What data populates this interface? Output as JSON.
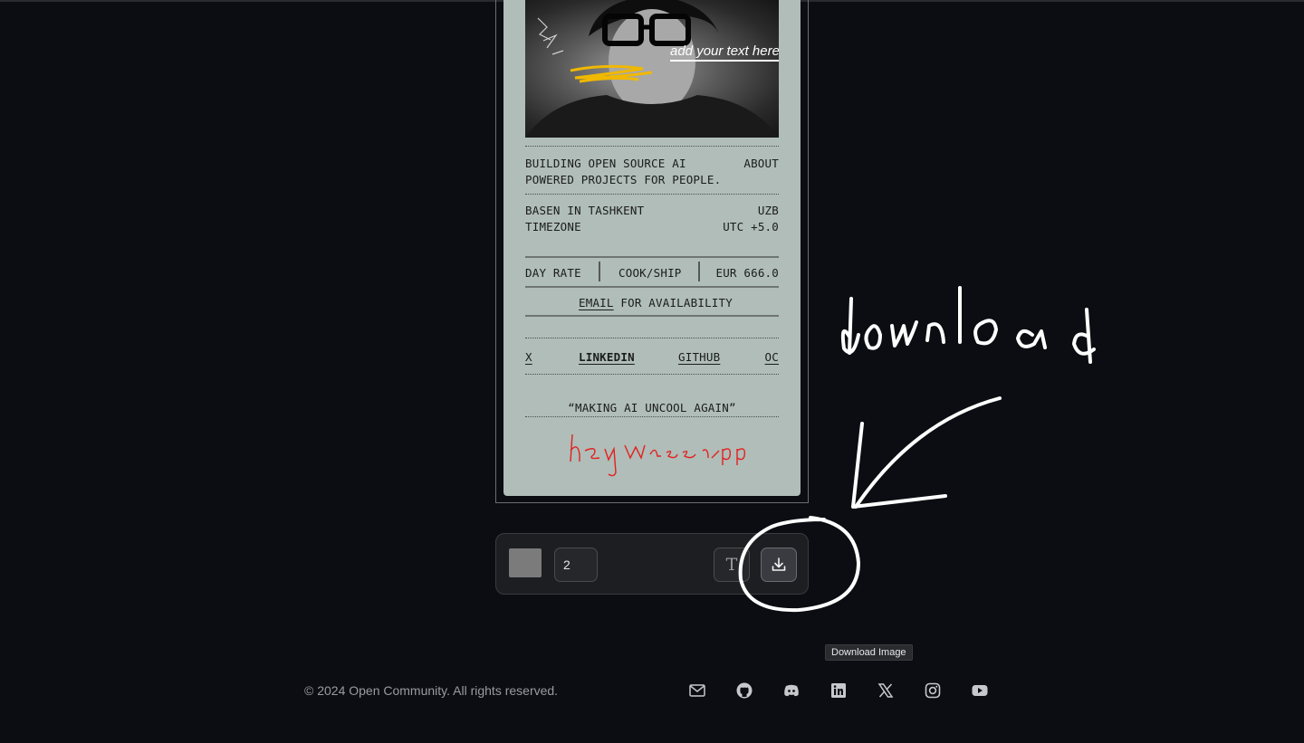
{
  "card": {
    "photo_caption": "add your text here",
    "about_text_1": "BUILDING OPEN SOURCE AI",
    "about_text_2": "POWERED PROJECTS FOR PEOPLE.",
    "about_label": "ABOUT",
    "location_1": "BASEN IN TASHKENT",
    "location_2": "TIMEZONE",
    "country": "UZB",
    "timezone": "UTC +5.0",
    "rate_label": "DAY RATE",
    "rate_task": "COOK/SHIP",
    "rate_value": "EUR 666.0",
    "email_link": "EMAIL",
    "email_suffix": " FOR AVAILABILITY",
    "links": [
      "X",
      "LINKEDIN",
      "GITHUB",
      "OC"
    ],
    "quote": "“MAKING AI UNCOOL AGAIN”",
    "signature": "hey wassup"
  },
  "toolbar": {
    "swatch_color": "#7b7b7b",
    "stroke_size": "2",
    "text_tool_glyph": "T",
    "download_icon": "download-icon"
  },
  "tooltip": "Download Image",
  "annotation": "download",
  "footer": {
    "copyright": "© 2024 Open Community. All rights reserved.",
    "socials": [
      "mail-icon",
      "github-icon",
      "discord-icon",
      "linkedin-icon",
      "x-icon",
      "instagram-icon",
      "youtube-icon"
    ]
  }
}
